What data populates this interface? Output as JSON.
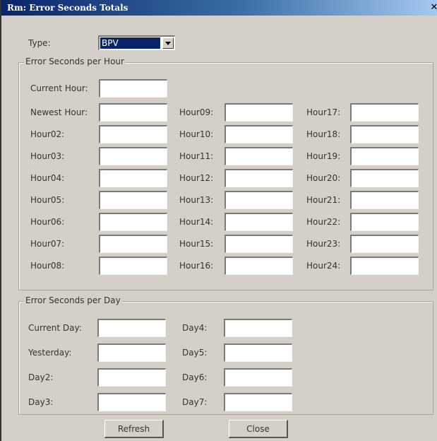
{
  "window": {
    "title": "Rm: Error Seconds Totals",
    "close_glyph": "✕"
  },
  "type": {
    "label": "Type:",
    "value": "BPV"
  },
  "hour_group": {
    "title": "Error Seconds per Hour",
    "current_label": "Current Hour:",
    "col1": [
      "Newest Hour:",
      "Hour02:",
      "Hour03:",
      "Hour04:",
      "Hour05:",
      "Hour06:",
      "Hour07:",
      "Hour08:"
    ],
    "col2": [
      "Hour09:",
      "Hour10:",
      "Hour11:",
      "Hour12:",
      "Hour13:",
      "Hour14:",
      "Hour15:",
      "Hour16:"
    ],
    "col3": [
      "Hour17:",
      "Hour18:",
      "Hour19:",
      "Hour20:",
      "Hour21:",
      "Hour22:",
      "Hour23:",
      "Hour24:"
    ]
  },
  "day_group": {
    "title": "Error Seconds per Day",
    "col1": [
      "Current Day:",
      "Yesterday:",
      "Day2:",
      "Day3:"
    ],
    "col2": [
      "Day4:",
      "Day5:",
      "Day6:",
      "Day7:"
    ]
  },
  "buttons": {
    "refresh": "Refresh",
    "close": "Close"
  }
}
